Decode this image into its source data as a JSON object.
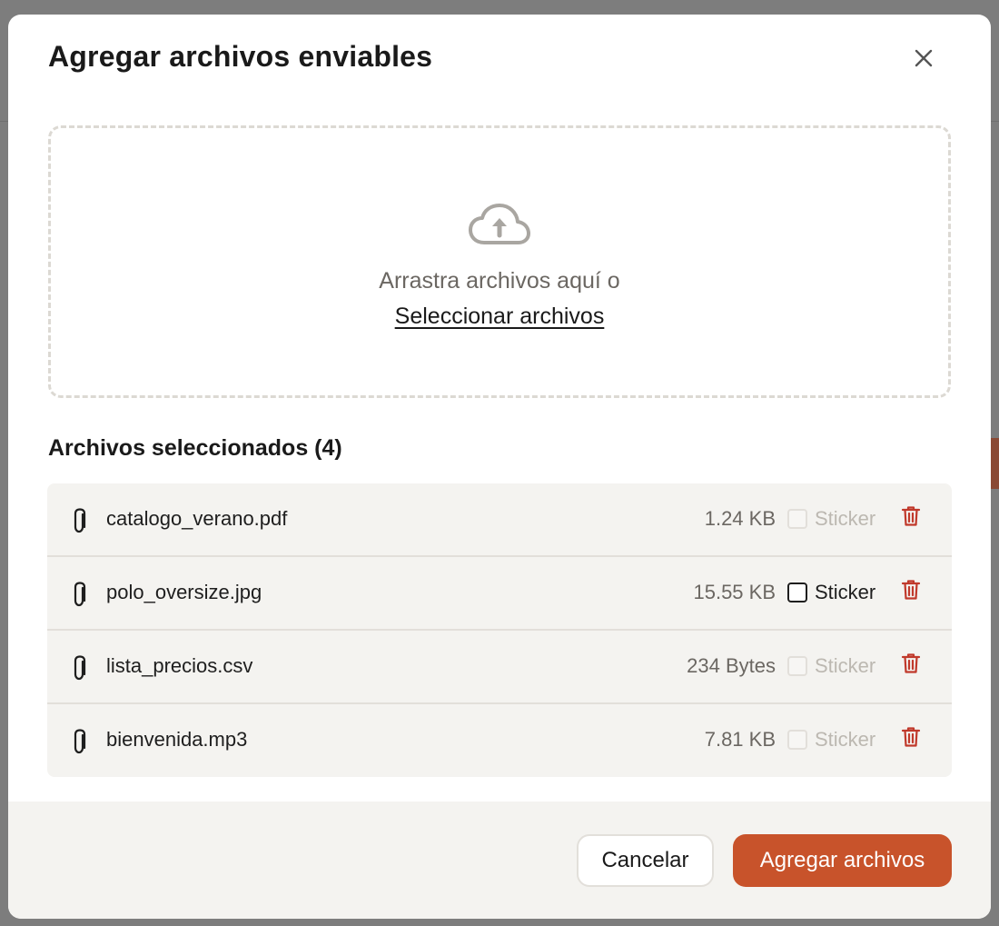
{
  "modal": {
    "title": "Agregar archivos enviables"
  },
  "dropzone": {
    "icon": "cloud-upload-icon",
    "text": "Arrastra archivos aquí o",
    "link_label": "Seleccionar archivos"
  },
  "selected": {
    "title": "Archivos seleccionados (4)",
    "files": [
      {
        "name": "catalogo_verano.pdf",
        "size": "1.24 KB",
        "sticker_label": "Sticker",
        "sticker_enabled": false
      },
      {
        "name": "polo_oversize.jpg",
        "size": "15.55 KB",
        "sticker_label": "Sticker",
        "sticker_enabled": true
      },
      {
        "name": "lista_precios.csv",
        "size": "234 Bytes",
        "sticker_label": "Sticker",
        "sticker_enabled": false
      },
      {
        "name": "bienvenida.mp3",
        "size": "7.81 KB",
        "sticker_label": "Sticker",
        "sticker_enabled": false
      }
    ]
  },
  "footer": {
    "cancel_label": "Cancelar",
    "submit_label": "Agregar archivos"
  },
  "colors": {
    "primary": "#c8532b",
    "danger": "#c0392b",
    "surface": "#f4f3f0",
    "muted_text": "#6b6762"
  }
}
